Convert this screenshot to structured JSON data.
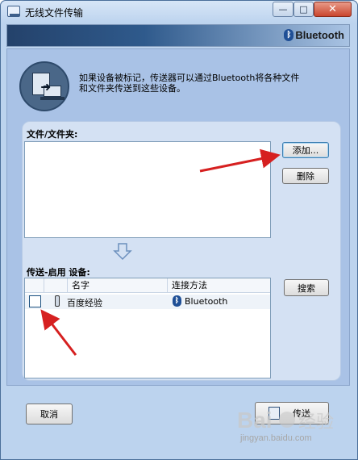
{
  "window": {
    "title": "无线文件传输",
    "minimize_label": "—",
    "maximize_label": "□",
    "close_label": "✕"
  },
  "banner": {
    "brand_text": "Bluetooth",
    "brand_icon": "bluetooth-icon"
  },
  "info": {
    "text_line1": "如果设备被标记，传送器可以通过Bluetooth将各种文件",
    "text_line2": "和文件夹传送到这些设备。"
  },
  "files": {
    "label": "文件/文件夹:",
    "items": [],
    "add_button": "添加...",
    "delete_button": "删除"
  },
  "devices": {
    "label": "传送-启用 设备:",
    "columns": [
      "",
      "",
      "名字",
      "连接方法"
    ],
    "rows": [
      {
        "checked": false,
        "icon": "phone-icon",
        "name": "百度经验",
        "method_icon": "bluetooth-icon",
        "method": "Bluetooth"
      }
    ],
    "search_button": "搜索"
  },
  "footer": {
    "cancel_button": "取消",
    "send_button": "传送"
  },
  "colors": {
    "annotation_arrow": "#d62020",
    "accent": "#1f4f96"
  },
  "watermark": {
    "text": "jingyan.baidu.com"
  }
}
